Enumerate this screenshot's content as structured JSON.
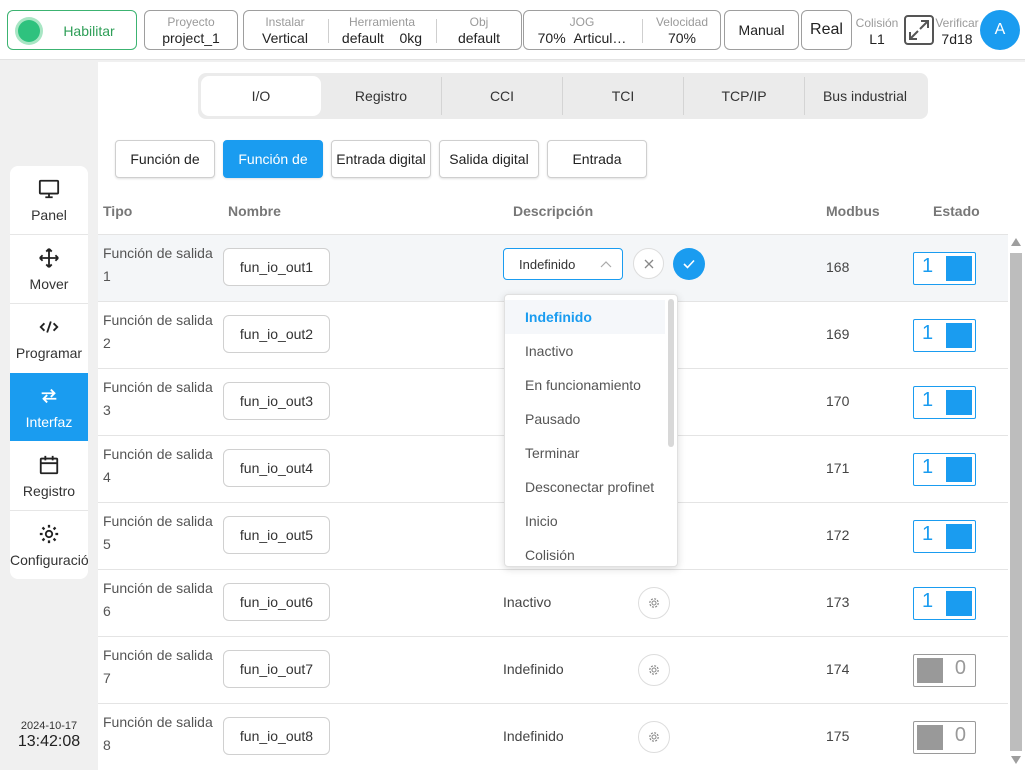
{
  "topbar": {
    "enable_label": "Habilitar",
    "project": {
      "caption": "Proyecto",
      "value": "project_1"
    },
    "install": {
      "caption": "Instalar",
      "value": "Vertical"
    },
    "tool": {
      "caption": "Herramienta",
      "value": "default",
      "value2": "0kg"
    },
    "obj": {
      "caption": "Obj",
      "value": "default"
    },
    "jog": {
      "caption": "JOG",
      "value": "70%",
      "value2": "Articul…"
    },
    "speed": {
      "caption": "Velocidad",
      "value": "70%"
    },
    "manual_label": "Manual",
    "real_label": "Real",
    "collision": {
      "caption": "Colisión",
      "value": "L1"
    },
    "verify": {
      "caption": "Verificar",
      "value": "7d18"
    },
    "avatar_letter": "A",
    "accent_color": "#1a9cf0"
  },
  "sidebar": {
    "items": [
      {
        "label": "Panel",
        "icon": "monitor-icon"
      },
      {
        "label": "Mover",
        "icon": "move-icon"
      },
      {
        "label": "Programar",
        "icon": "code-icon"
      },
      {
        "label": "Interfaz",
        "icon": "swap-icon"
      },
      {
        "label": "Registro",
        "icon": "calendar-icon"
      },
      {
        "label": "Configuración",
        "icon": "gear-icon"
      }
    ],
    "date": "2024-10-17",
    "time": "13:42:08"
  },
  "tabs": [
    "I/O",
    "Registro",
    "CCI",
    "TCI",
    "TCP/IP",
    "Bus industrial"
  ],
  "subtabs": [
    "Función de",
    "Función de",
    "Entrada digital",
    "Salida digital",
    "Entrada"
  ],
  "table": {
    "headers": {
      "tipo": "Tipo",
      "nombre": "Nombre",
      "descripcion": "Descripción",
      "modbus": "Modbus",
      "estado": "Estado"
    },
    "rows": [
      {
        "tipo": "Función de salida 1",
        "nombre": "fun_io_out1",
        "descripcion": "",
        "modbus": "168",
        "estado": "1"
      },
      {
        "tipo": "Función de salida 2",
        "nombre": "fun_io_out2",
        "descripcion": "",
        "modbus": "169",
        "estado": "1"
      },
      {
        "tipo": "Función de salida 3",
        "nombre": "fun_io_out3",
        "descripcion": "",
        "modbus": "170",
        "estado": "1"
      },
      {
        "tipo": "Función de salida 4",
        "nombre": "fun_io_out4",
        "descripcion": "",
        "modbus": "171",
        "estado": "1"
      },
      {
        "tipo": "Función de salida 5",
        "nombre": "fun_io_out5",
        "descripcion": "",
        "modbus": "172",
        "estado": "1"
      },
      {
        "tipo": "Función de salida 6",
        "nombre": "fun_io_out6",
        "descripcion": "Inactivo",
        "modbus": "173",
        "estado": "1"
      },
      {
        "tipo": "Función de salida 7",
        "nombre": "fun_io_out7",
        "descripcion": "Indefinido",
        "modbus": "174",
        "estado": "0"
      },
      {
        "tipo": "Función de salida 8",
        "nombre": "fun_io_out8",
        "descripcion": "Indefinido",
        "modbus": "175",
        "estado": "0"
      }
    ]
  },
  "editor": {
    "selected_value": "Indefinido",
    "options": [
      "Indefinido",
      "Inactivo",
      "En funcionamiento",
      "Pausado",
      "Terminar",
      "Desconectar profinet",
      "Inicio",
      "Colisión"
    ]
  }
}
